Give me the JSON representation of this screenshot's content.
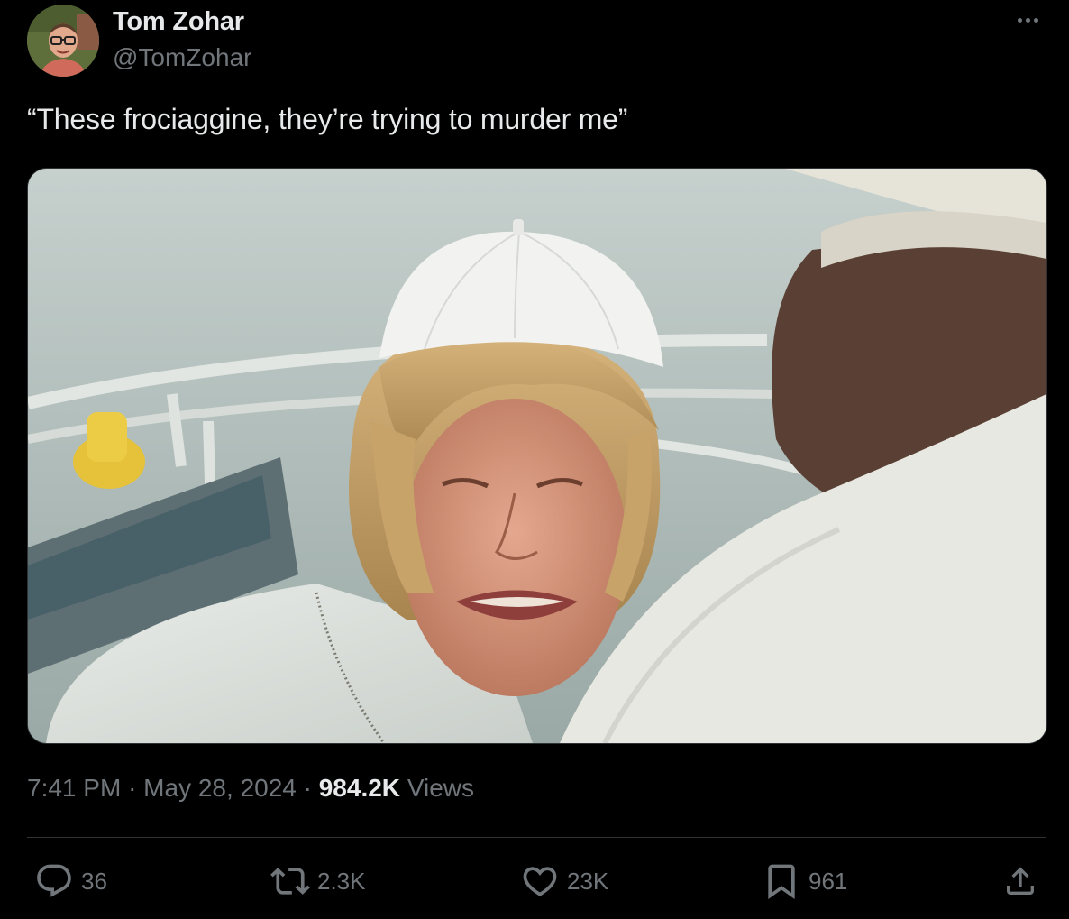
{
  "author": {
    "name": "Tom Zohar",
    "handle": "@TomZohar"
  },
  "tweet": {
    "text": "“These frociaggine, they’re trying to murder me”"
  },
  "meta": {
    "time": "7:41 PM",
    "separator": "·",
    "date": "May 28, 2024",
    "views_count": "984.2K",
    "views_label": "Views"
  },
  "actions": {
    "replies": "36",
    "reposts": "2.3K",
    "likes": "23K",
    "bookmarks": "961"
  },
  "icons": {
    "more": "more-horizontal-icon",
    "reply": "reply-icon",
    "repost": "repost-icon",
    "like": "heart-icon",
    "bookmark": "bookmark-icon",
    "share": "share-icon"
  },
  "colors": {
    "background": "#000000",
    "text_primary": "#e7e9ea",
    "text_secondary": "#71767b",
    "border": "#2f3336"
  }
}
